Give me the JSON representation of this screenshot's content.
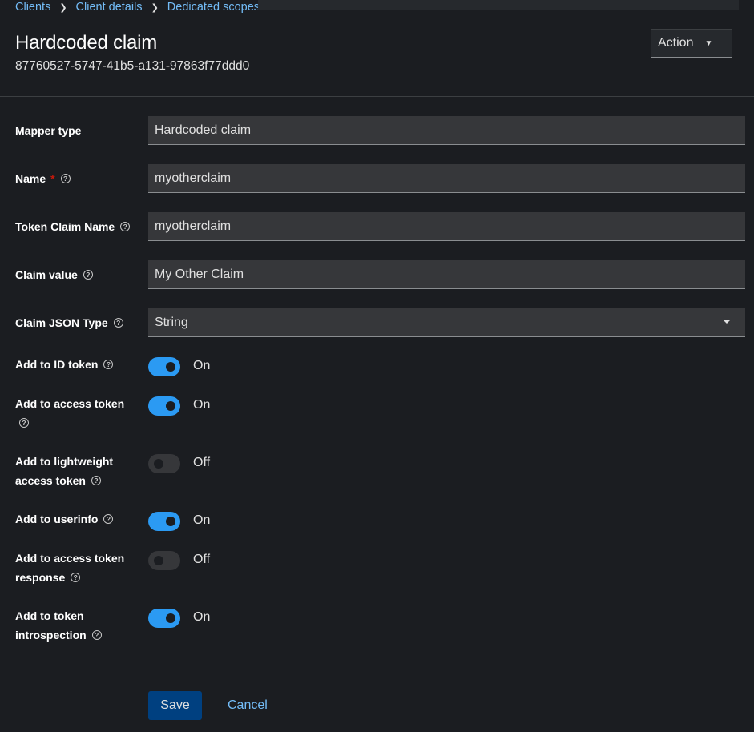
{
  "breadcrumb": [
    "Clients",
    "Client details",
    "Dedicated scopes"
  ],
  "header": {
    "title": "Hardcoded claim",
    "subtitle": "87760527-5747-41b5-a131-97863f77ddd0",
    "action_label": "Action"
  },
  "form": {
    "mapper_type": {
      "label": "Mapper type",
      "value": "Hardcoded claim"
    },
    "name": {
      "label": "Name",
      "required_mark": "*",
      "value": "myotherclaim"
    },
    "token_claim_name": {
      "label": "Token Claim Name",
      "value": "myotherclaim"
    },
    "claim_value": {
      "label": "Claim value",
      "value": "My Other Claim"
    },
    "claim_json_type": {
      "label": "Claim JSON Type",
      "value": "String"
    },
    "toggles": [
      {
        "label_lines": [
          "Add to ID token"
        ],
        "state": "On"
      },
      {
        "label_lines": [
          "Add to access token"
        ],
        "state": "On"
      },
      {
        "label_lines": [
          "Add to lightweight",
          "access token"
        ],
        "state": "Off"
      },
      {
        "label_lines": [
          "Add to userinfo"
        ],
        "state": "On"
      },
      {
        "label_lines": [
          "Add to access token",
          "response"
        ],
        "state": "Off"
      },
      {
        "label_lines": [
          "Add to token",
          "introspection"
        ],
        "state": "On"
      }
    ]
  },
  "footer": {
    "save_label": "Save",
    "cancel_label": "Cancel"
  },
  "help_glyph": "?",
  "colors": {
    "accent": "#2b9af3",
    "link": "#73bcf7",
    "primary_button": "#004080",
    "required": "#c9190b"
  }
}
